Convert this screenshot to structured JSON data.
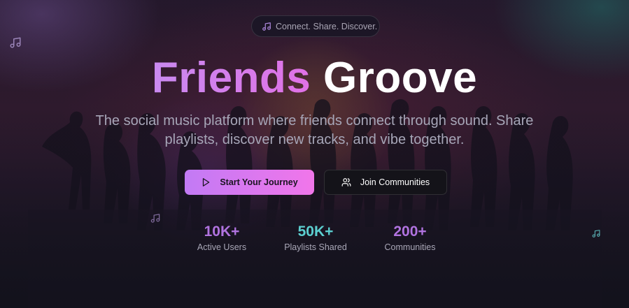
{
  "tagline": "Connect. Share. Discover.",
  "title": {
    "word1": "Friends",
    "word2": "Groove"
  },
  "subtitle": "The social music platform where friends connect through sound. Share playlists, discover new tracks, and vibe together.",
  "buttons": {
    "primary": "Start Your Journey",
    "secondary": "Join Communities"
  },
  "stats": [
    {
      "value": "10K+",
      "label": "Active Users",
      "color": "#b173e0"
    },
    {
      "value": "50K+",
      "label": "Playlists Shared",
      "color": "#5ccfd0"
    },
    {
      "value": "200+",
      "label": "Communities",
      "color": "#b173e0"
    }
  ],
  "icons": {
    "tagline": "music-note-icon",
    "primary": "play-icon",
    "secondary": "users-icon"
  },
  "colors": {
    "accent_purple": "#c98af0",
    "accent_pink": "#f176ea",
    "accent_teal": "#5ccfd0"
  }
}
